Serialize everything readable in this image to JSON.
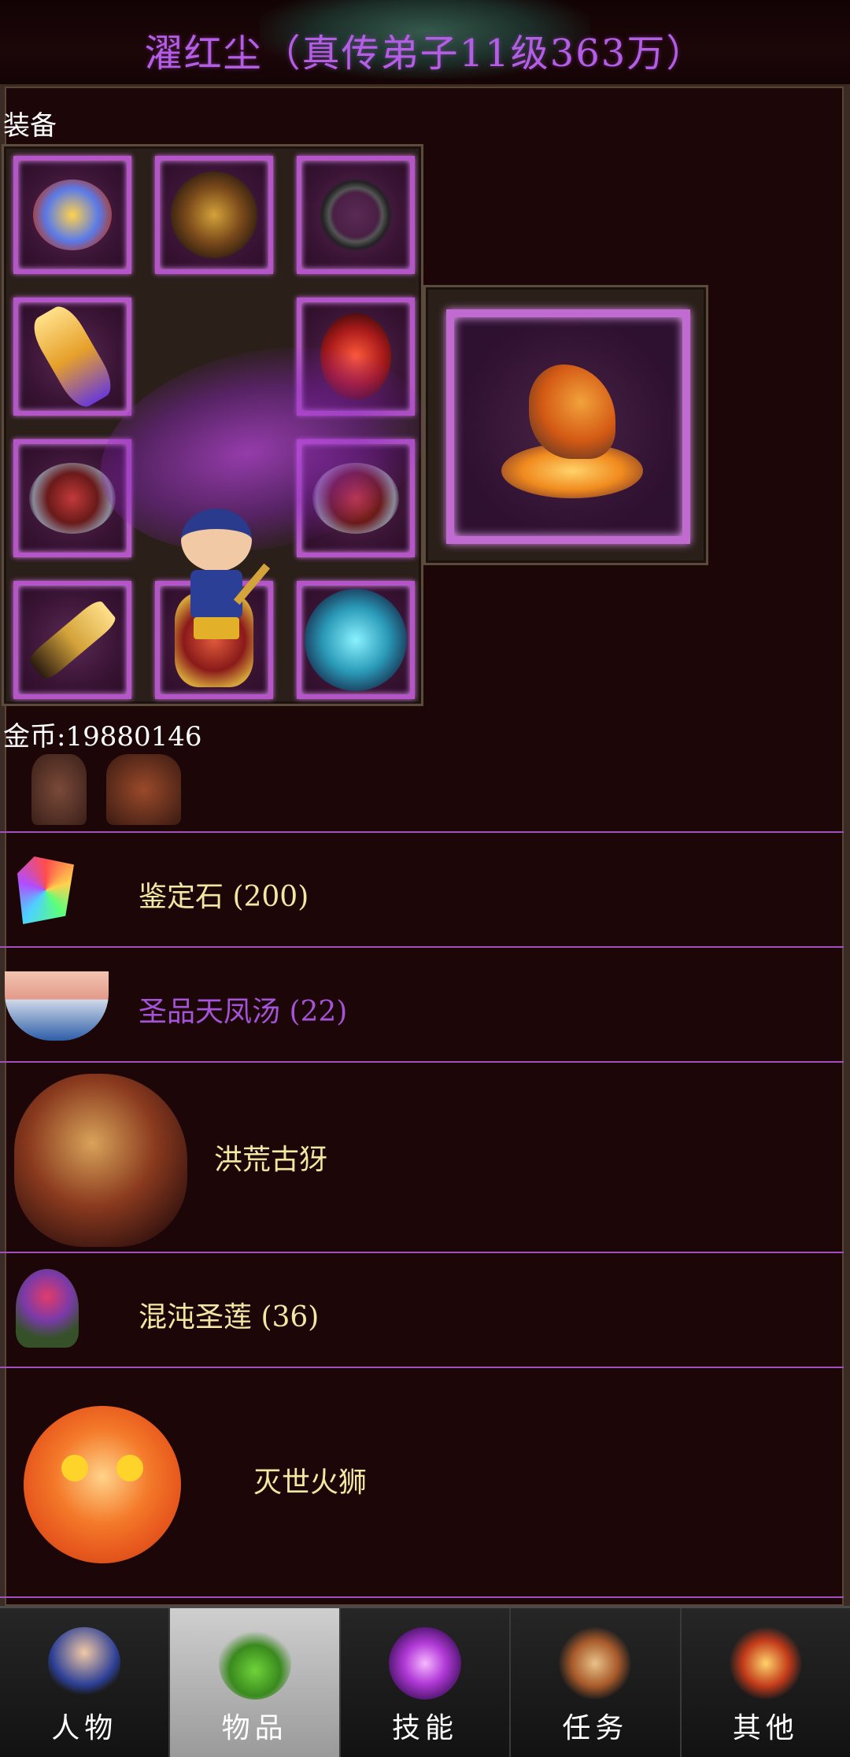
{
  "header": {
    "title": "濯红尘（真传弟子11级363万）"
  },
  "equipment": {
    "section_label": "装备",
    "slots": [
      {
        "icon": "winged-helmet-icon"
      },
      {
        "icon": "dragon-armor-icon"
      },
      {
        "icon": "necklace-icon"
      },
      {
        "icon": "golden-sword-icon"
      },
      {
        "icon": "red-dragon-icon"
      },
      {
        "icon": "bracer-icon"
      },
      {
        "icon": "bracer-icon"
      },
      {
        "icon": "dagger-icon"
      },
      {
        "icon": "red-boots-icon"
      },
      {
        "icon": "blue-wolf-icon"
      }
    ],
    "pet_icon": "fire-beast-icon"
  },
  "gold": {
    "text": "金币:19880146"
  },
  "items": [
    {
      "icon": "boots-icon",
      "label": ""
    },
    {
      "icon": "rainbow-gem-icon",
      "label": "鉴定石 (200)",
      "color": "#f3e7a2"
    },
    {
      "icon": "soup-bowl-icon",
      "label": "圣品天凤汤 (22)",
      "color": "#a553d9"
    },
    {
      "icon": "ancient-beast-icon",
      "label": "洪荒古犽",
      "color": "#f3e7a2"
    },
    {
      "icon": "holy-lotus-icon",
      "label": "混沌圣莲 (36)",
      "color": "#f3e7a2"
    },
    {
      "icon": "fire-lion-icon",
      "label": "灭世火狮",
      "color": "#f3e7a2"
    }
  ],
  "bottom_nav": {
    "tabs": [
      {
        "label": "人物",
        "icon": "character-icon",
        "active": false
      },
      {
        "label": "物品",
        "icon": "potion-icon",
        "active": true
      },
      {
        "label": "技能",
        "icon": "skill-orb-icon",
        "active": false
      },
      {
        "label": "任务",
        "icon": "quest-icon",
        "active": false
      },
      {
        "label": "其他",
        "icon": "other-sword-icon",
        "active": false
      }
    ]
  }
}
